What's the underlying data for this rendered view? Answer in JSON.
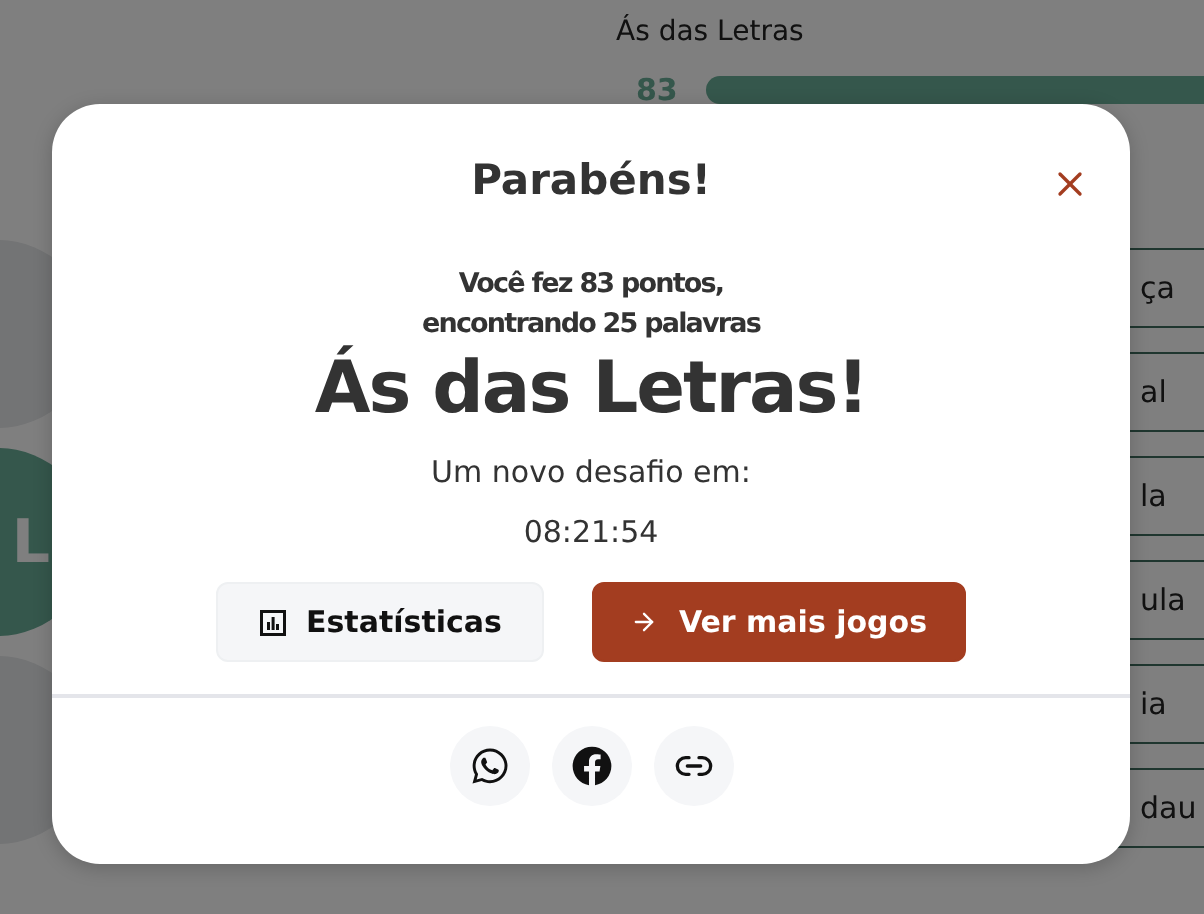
{
  "page": {
    "game_title": "Ás das Letras",
    "score": "83"
  },
  "board": {
    "tiles": [
      {
        "kind": "outer"
      },
      {
        "kind": "center",
        "letter": "L"
      },
      {
        "kind": "outer"
      }
    ]
  },
  "words": [
    {
      "text": "ça"
    },
    {
      "text": "al"
    },
    {
      "text": "la"
    },
    {
      "text": "ula"
    },
    {
      "text": "ia"
    },
    {
      "text": "dau"
    }
  ],
  "modal": {
    "title": "Parabéns!",
    "summary_line_1": "Você fez 83 pontos,",
    "summary_line_2": "encontrando 25 palavras",
    "rank": "Ás das Letras!",
    "next_label": "Um novo desafio em:",
    "countdown": "08:21:54",
    "buttons": [
      {
        "kind": "secondary",
        "label": "Estatísticas"
      },
      {
        "kind": "primary",
        "label": "Ver mais jogos"
      }
    ],
    "share": [
      {
        "kind": "whatsapp"
      },
      {
        "kind": "facebook"
      },
      {
        "kind": "link"
      }
    ]
  }
}
